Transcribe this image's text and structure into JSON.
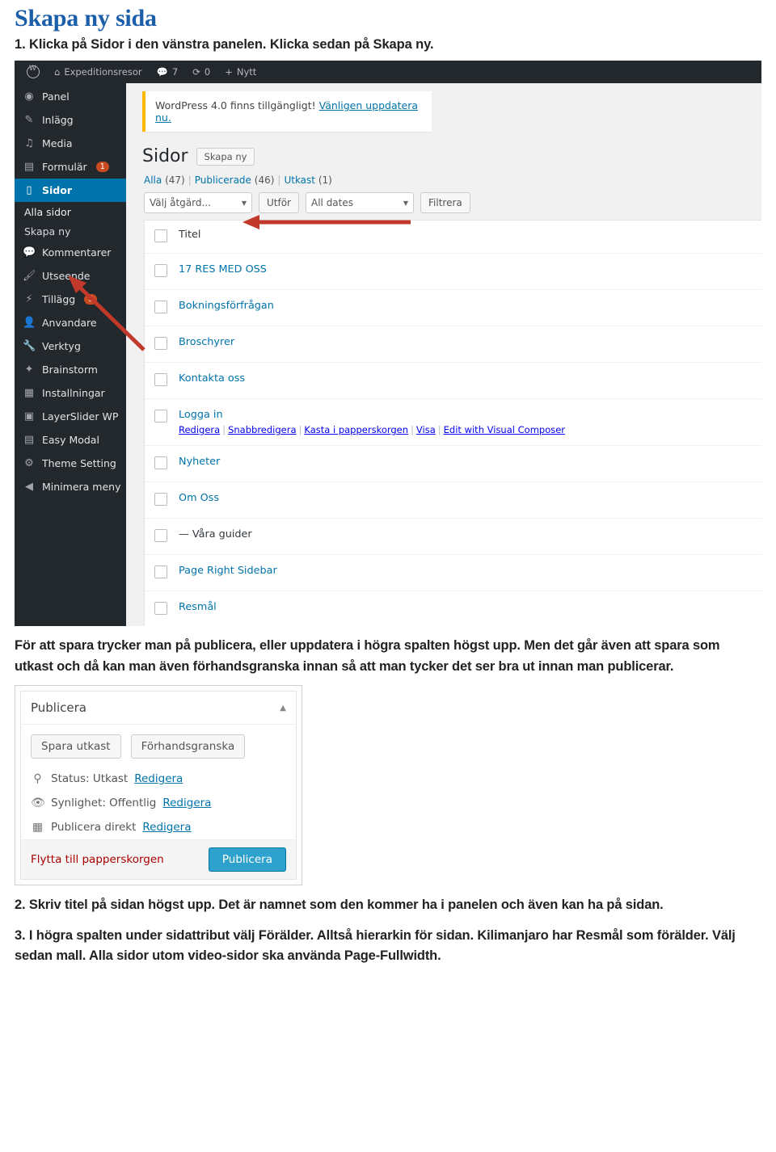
{
  "doc": {
    "title": "Skapa ny sida",
    "step1": "1. Klicka på Sidor i den vänstra panelen. Klicka sedan på Skapa ny.",
    "par1": "För att spara trycker man på publicera, eller uppdatera i högra spalten högst upp. Men det går även att spara som utkast och då kan man även förhandsgranska innan så att man tycker det ser bra ut innan man publicerar.",
    "step2": "2. Skriv titel på sidan högst upp. Det är namnet som den kommer ha i panelen och även kan ha på sidan.",
    "step3": "3. I högra spalten under sidattribut välj Förälder. Alltså hierarkin för sidan. Kilimanjaro har Resmål som förälder. Välj sedan mall. Alla sidor utom video-sidor ska använda Page-Fullwidth."
  },
  "wp": {
    "adminbar": {
      "site_name": "Expeditionsresor",
      "comments_count": "7",
      "updates_count": "0",
      "new_label": "Nytt"
    },
    "menu": [
      {
        "label": "Panel",
        "icon": "dashboard-icon",
        "badge": ""
      },
      {
        "label": "Inlägg",
        "icon": "pin-icon",
        "badge": ""
      },
      {
        "label": "Media",
        "icon": "media-icon",
        "badge": ""
      },
      {
        "label": "Formulär",
        "icon": "forms-icon",
        "badge": "1"
      },
      {
        "label": "Sidor",
        "icon": "pages-icon",
        "badge": "",
        "current": true
      },
      {
        "label": "Kommentarer",
        "icon": "comments-icon",
        "badge": ""
      },
      {
        "label": "Utseende",
        "icon": "appearance-icon",
        "badge": ""
      },
      {
        "label": "Tillägg",
        "icon": "plugins-icon",
        "badge": "5"
      },
      {
        "label": "Anvandare",
        "icon": "users-icon",
        "badge": ""
      },
      {
        "label": "Verktyg",
        "icon": "tools-icon",
        "badge": ""
      },
      {
        "label": "Brainstorm",
        "icon": "brainstorm-icon",
        "badge": ""
      },
      {
        "label": "Installningar",
        "icon": "settings-icon",
        "badge": ""
      },
      {
        "label": "LayerSlider WP",
        "icon": "layerslider-icon",
        "badge": ""
      },
      {
        "label": "Easy Modal",
        "icon": "modal-icon",
        "badge": ""
      },
      {
        "label": "Theme Setting",
        "icon": "gear-icon",
        "badge": ""
      },
      {
        "label": "Minimera meny",
        "icon": "collapse-icon",
        "badge": ""
      }
    ],
    "submenu": [
      {
        "label": "Alla sidor"
      },
      {
        "label": "Skapa ny"
      }
    ],
    "update_nag": {
      "text_before": "WordPress 4.0 finns tillgängligt! ",
      "link": "Vänligen uppdatera nu."
    },
    "page_heading": "Sidor",
    "add_new_button": "Skapa ny",
    "filters": [
      {
        "label": "Alla",
        "count": "(47)"
      },
      {
        "label": "Publicerade",
        "count": "(46)"
      },
      {
        "label": "Utkast",
        "count": "(1)"
      }
    ],
    "bulk_action_value": "Välj åtgärd...",
    "apply_button": "Utför",
    "dates_value": "All dates",
    "filter_button": "Filtrera",
    "table_header": "Titel",
    "rows": [
      {
        "title": "17 RES MED OSS",
        "link": true
      },
      {
        "title": "Bokningsförfrågan",
        "link": true
      },
      {
        "title": "Broschyrer",
        "link": true
      },
      {
        "title": "Kontakta oss",
        "link": true
      },
      {
        "title": "Logga in",
        "link": true,
        "actions": [
          "Redigera",
          "Snabbredigera",
          "Kasta i papperskorgen",
          "Visa",
          "Edit with Visual Composer"
        ]
      },
      {
        "title": "Nyheter",
        "link": true
      },
      {
        "title": "Om Oss",
        "link": true
      },
      {
        "title": "— Våra guider",
        "link": false
      },
      {
        "title": "Page Right Sidebar",
        "link": true
      },
      {
        "title": "Resmål",
        "link": true
      }
    ]
  },
  "publish_box": {
    "title": "Publicera",
    "save_draft": "Spara utkast",
    "preview": "Förhandsgranska",
    "status_label": "Status: Utkast",
    "status_edit": "Redigera",
    "visibility_label": "Synlighet: Offentlig",
    "visibility_edit": "Redigera",
    "schedule_label": "Publicera direkt",
    "schedule_edit": "Redigera",
    "trash": "Flytta till papperskorgen",
    "publish": "Publicera"
  }
}
